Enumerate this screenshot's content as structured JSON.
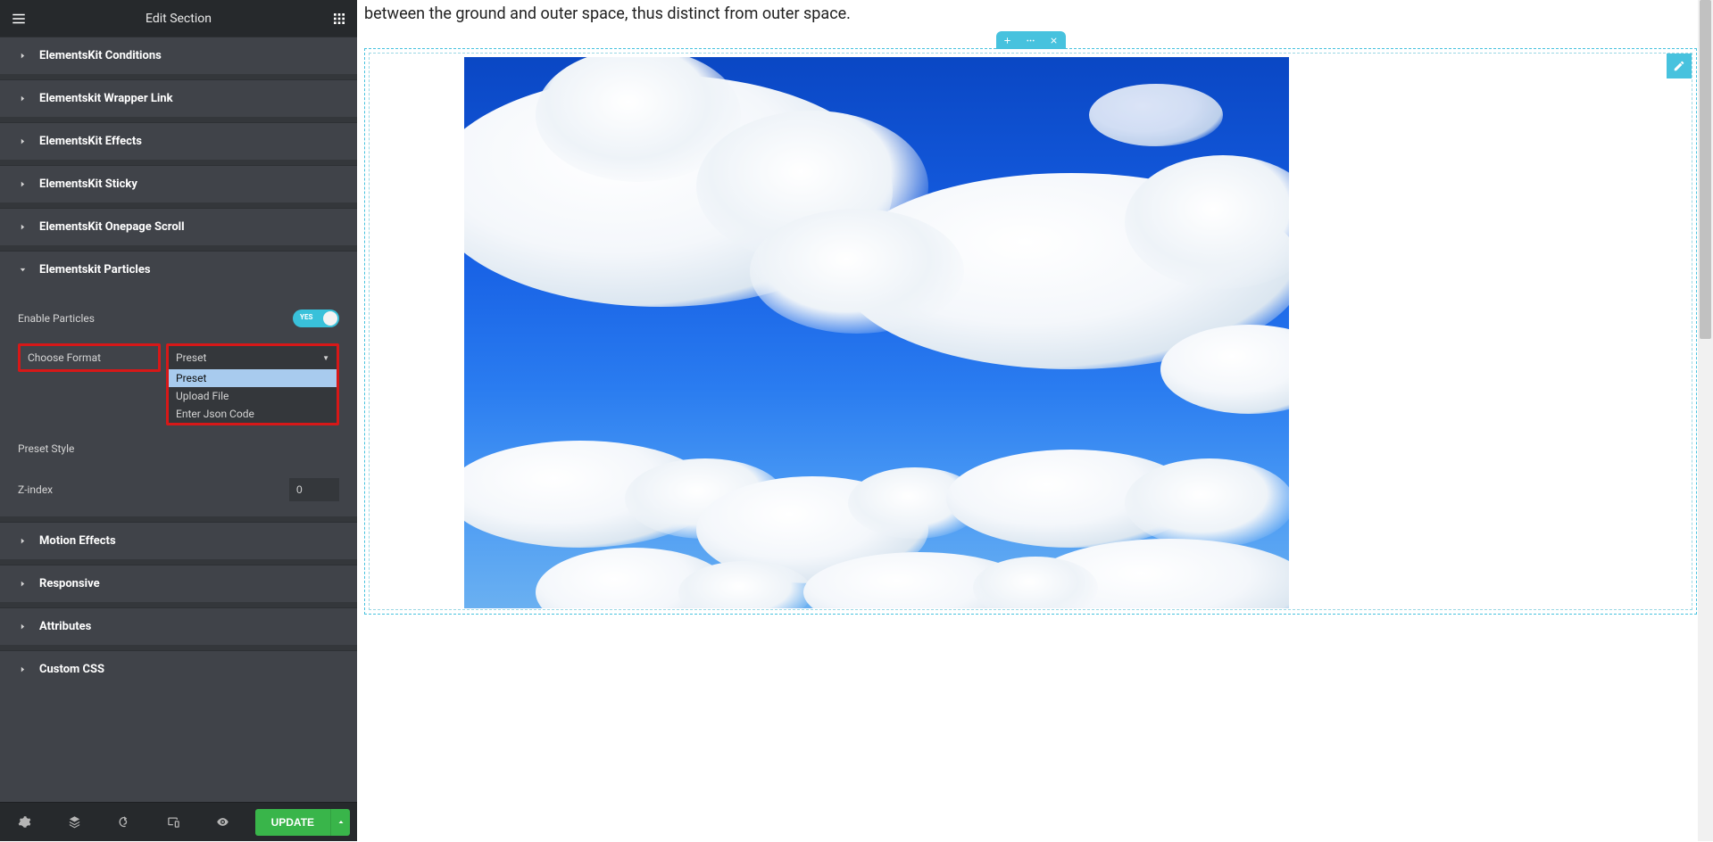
{
  "panel": {
    "title": "Edit Section",
    "accordion": {
      "conditions": "ElementsKit Conditions",
      "wrapper_link": "Elementskit Wrapper Link",
      "effects": "ElementsKit Effects",
      "sticky": "ElementsKit Sticky",
      "onepage_scroll": "ElementsKit Onepage Scroll",
      "particles": "Elementskit Particles",
      "motion_effects": "Motion Effects",
      "responsive": "Responsive",
      "attributes": "Attributes",
      "custom_css": "Custom CSS"
    },
    "particles": {
      "enable_label": "Enable Particles",
      "enable_value": "YES",
      "choose_format_label": "Choose Format",
      "format_selected": "Preset",
      "format_options": {
        "preset": "Preset",
        "upload_file": "Upload File",
        "enter_json": "Enter Json Code"
      },
      "preset_style_label": "Preset Style",
      "zindex_label": "Z-index",
      "zindex_value": "0"
    },
    "footer": {
      "update_label": "UPDATE"
    }
  },
  "canvas": {
    "paragraph_text": "between the ground and outer space, thus distinct from outer space."
  }
}
